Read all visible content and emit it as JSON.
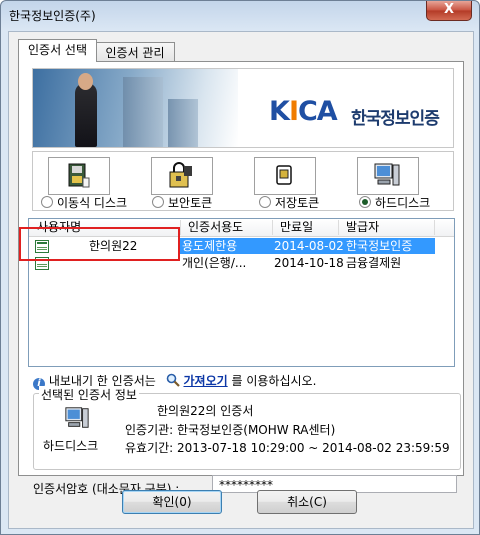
{
  "window": {
    "title": "한국정보인증(주)",
    "close_label": "X"
  },
  "tabs": [
    {
      "label": "인증서 선택"
    },
    {
      "label": "인증서 관리"
    }
  ],
  "banner": {
    "logo_k": "K",
    "logo_i": "I",
    "logo_ca": "CA",
    "company": "한국정보인증"
  },
  "storage": {
    "options": [
      {
        "label": "이동식 디스크",
        "icon": "usb-disk-icon",
        "selected": false
      },
      {
        "label": "보안토큰",
        "icon": "security-token-icon",
        "selected": false
      },
      {
        "label": "저장토큰",
        "icon": "smartcard-icon",
        "selected": false
      },
      {
        "label": "하드디스크",
        "icon": "computer-icon",
        "selected": true
      }
    ]
  },
  "cert_table": {
    "headers": [
      "사용자명",
      "인증서용도",
      "만료일",
      "발급자"
    ],
    "rows": [
      {
        "user": "한의원22",
        "usage": "용도제한용",
        "expiry": "2014-08-02",
        "issuer": "한국정보인증",
        "selected": true
      },
      {
        "user": "",
        "usage": "개인(은행/...",
        "expiry": "2014-10-18",
        "issuer": "금융결제원",
        "selected": false
      }
    ]
  },
  "info_line": {
    "before": "내보내기 한 인증서는",
    "link": "가져오기",
    "after": "를 이용하십시오."
  },
  "selected_info": {
    "group_label": "선택된 인증서 정보",
    "storage_label": "하드디스크",
    "cert_name": "한의원22의 인증서",
    "issuer_line": "인증기관: 한국정보인증(MOHW RA센터)",
    "validity_line": "유효기간: 2013-07-18 10:29:00 ~ 2014-08-02 23:59:59"
  },
  "password": {
    "label": "인증서암호 (대소문자 구분) :",
    "value": "*********"
  },
  "buttons": {
    "ok": "확인(0)",
    "cancel": "취소(C)"
  }
}
